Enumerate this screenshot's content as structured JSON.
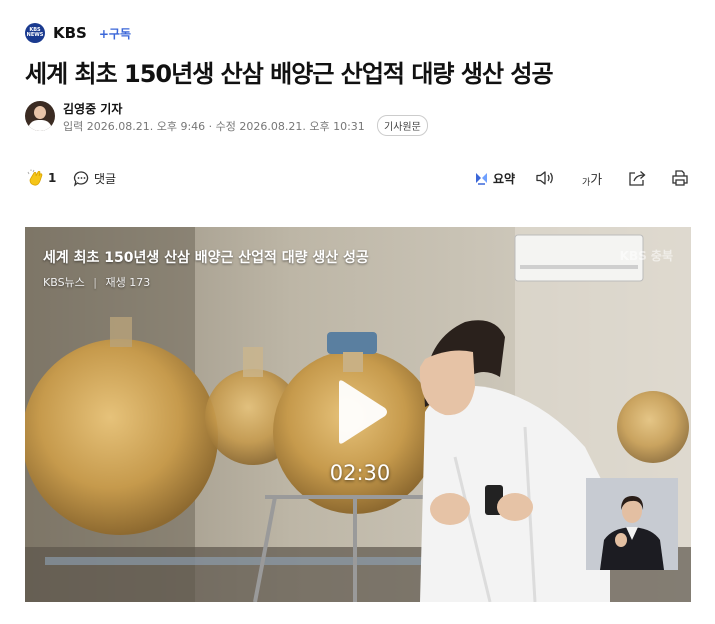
{
  "publisher": {
    "logo_text": "KBS NEWS",
    "name": "KBS",
    "subscribe": "+구독"
  },
  "article": {
    "title": "세계 최초 150년생 산삼 배양근 산업적 대량 생산 성공",
    "reporter": "김영중 기자",
    "dates": "입력 2026.08.21. 오후 9:46 · 수정 2026.08.21. 오후 10:31",
    "original_link": "기사원문"
  },
  "toolbar": {
    "like_count": "1",
    "comment_label": "댓글",
    "summary_label": "요약",
    "font_label_small": "가",
    "font_label_large": "가"
  },
  "video": {
    "title": "세계 최초 150년생 산삼 배양근 산업적 대량 생산 성공",
    "source": "KBS뉴스",
    "separator": "|",
    "plays": "재생 173",
    "duration": "02:30",
    "watermark": "KBS 충북"
  },
  "icons": [
    "clap-icon",
    "comment-icon",
    "summary-icon",
    "speaker-icon",
    "font-size-icon",
    "share-icon",
    "print-icon",
    "play-icon"
  ],
  "colors": {
    "accent": "#3b67d8",
    "logo": "#1a3a8f"
  }
}
